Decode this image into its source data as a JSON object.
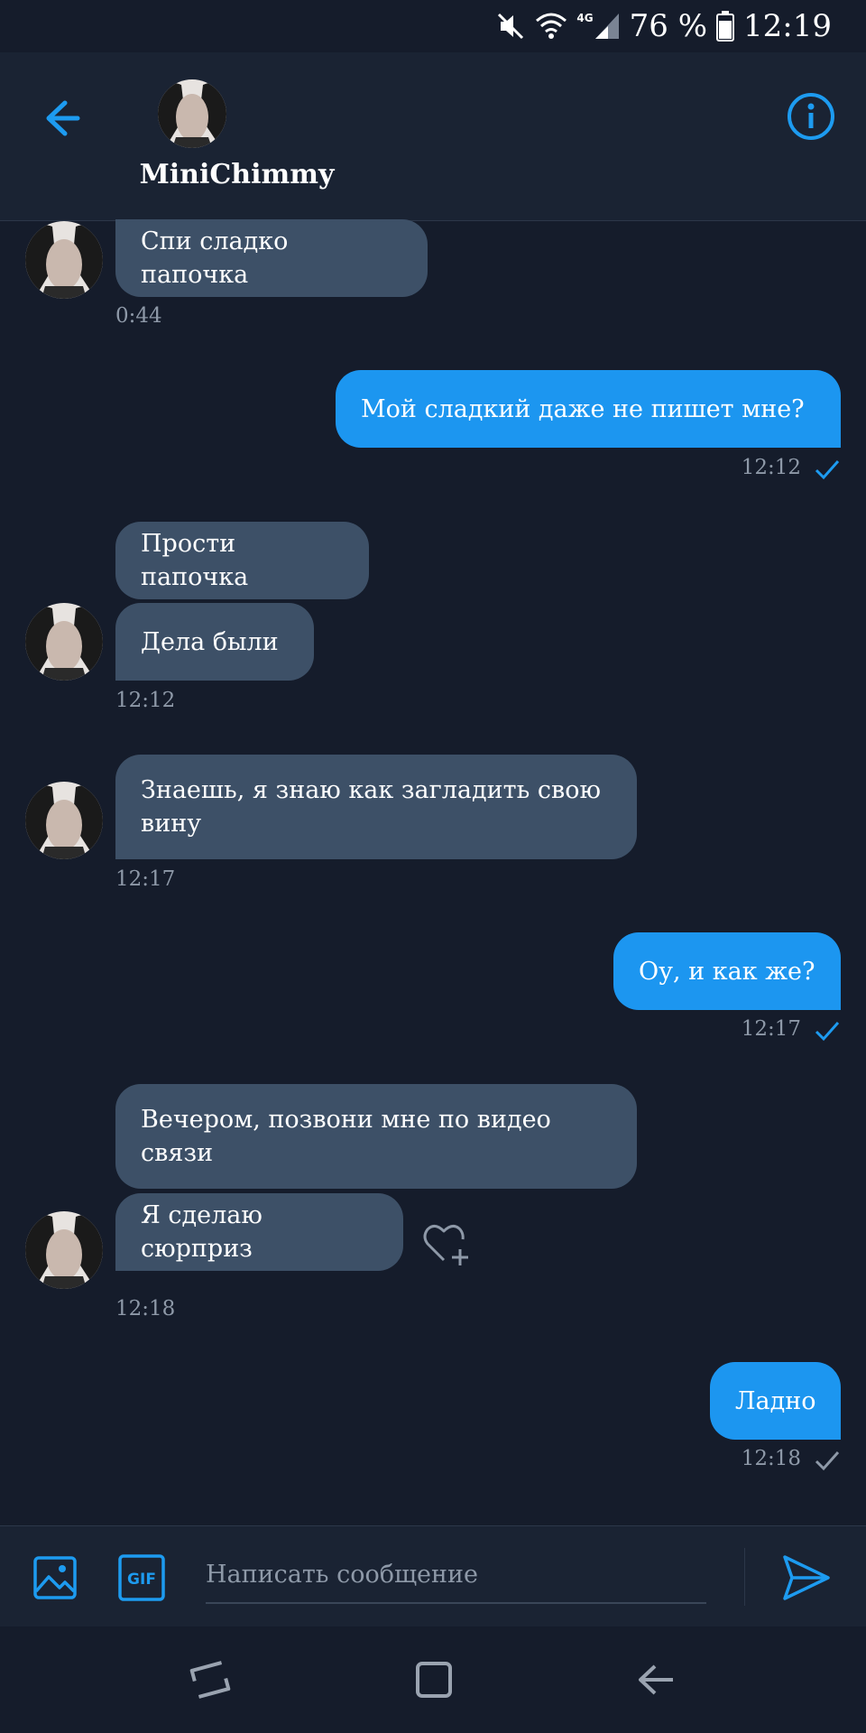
{
  "status_bar": {
    "network": "4G",
    "battery_percent": "76 %",
    "time": "12:19"
  },
  "header": {
    "contact_name": "MiniChimmy"
  },
  "messages": [
    {
      "text": "Спи сладко папочка",
      "time": "0:44"
    },
    {
      "text": "Мой сладкий даже не пишет мне?",
      "time": "12:12"
    },
    {
      "text": "Прости папочка"
    },
    {
      "text": "Дела были",
      "time": "12:12"
    },
    {
      "text": "Знаешь, я знаю как загладить свою вину",
      "time": "12:17"
    },
    {
      "text": "Оу, и как же?",
      "time": "12:17"
    },
    {
      "text": "Вечером, позвони мне по видео связи"
    },
    {
      "text": "Я сделаю сюрприз",
      "time": "12:18"
    },
    {
      "text": "Ладно",
      "time": "12:18"
    }
  ],
  "composer": {
    "placeholder": "Написать сообщение",
    "gif_label": "GIF"
  },
  "colors": {
    "background": "#151c2b",
    "incoming_bubble": "#3d5067",
    "outgoing_bubble": "#1c96f0",
    "accent": "#1d9bf0",
    "timestamp": "#8e99a8"
  },
  "icons": [
    "mute-icon",
    "wifi-icon",
    "signal-icon",
    "battery-icon",
    "back-arrow-icon",
    "info-icon",
    "checkmark-icon",
    "heart-plus-icon",
    "image-icon",
    "gif-icon",
    "send-icon",
    "recents-icon",
    "home-icon",
    "nav-back-icon"
  ]
}
